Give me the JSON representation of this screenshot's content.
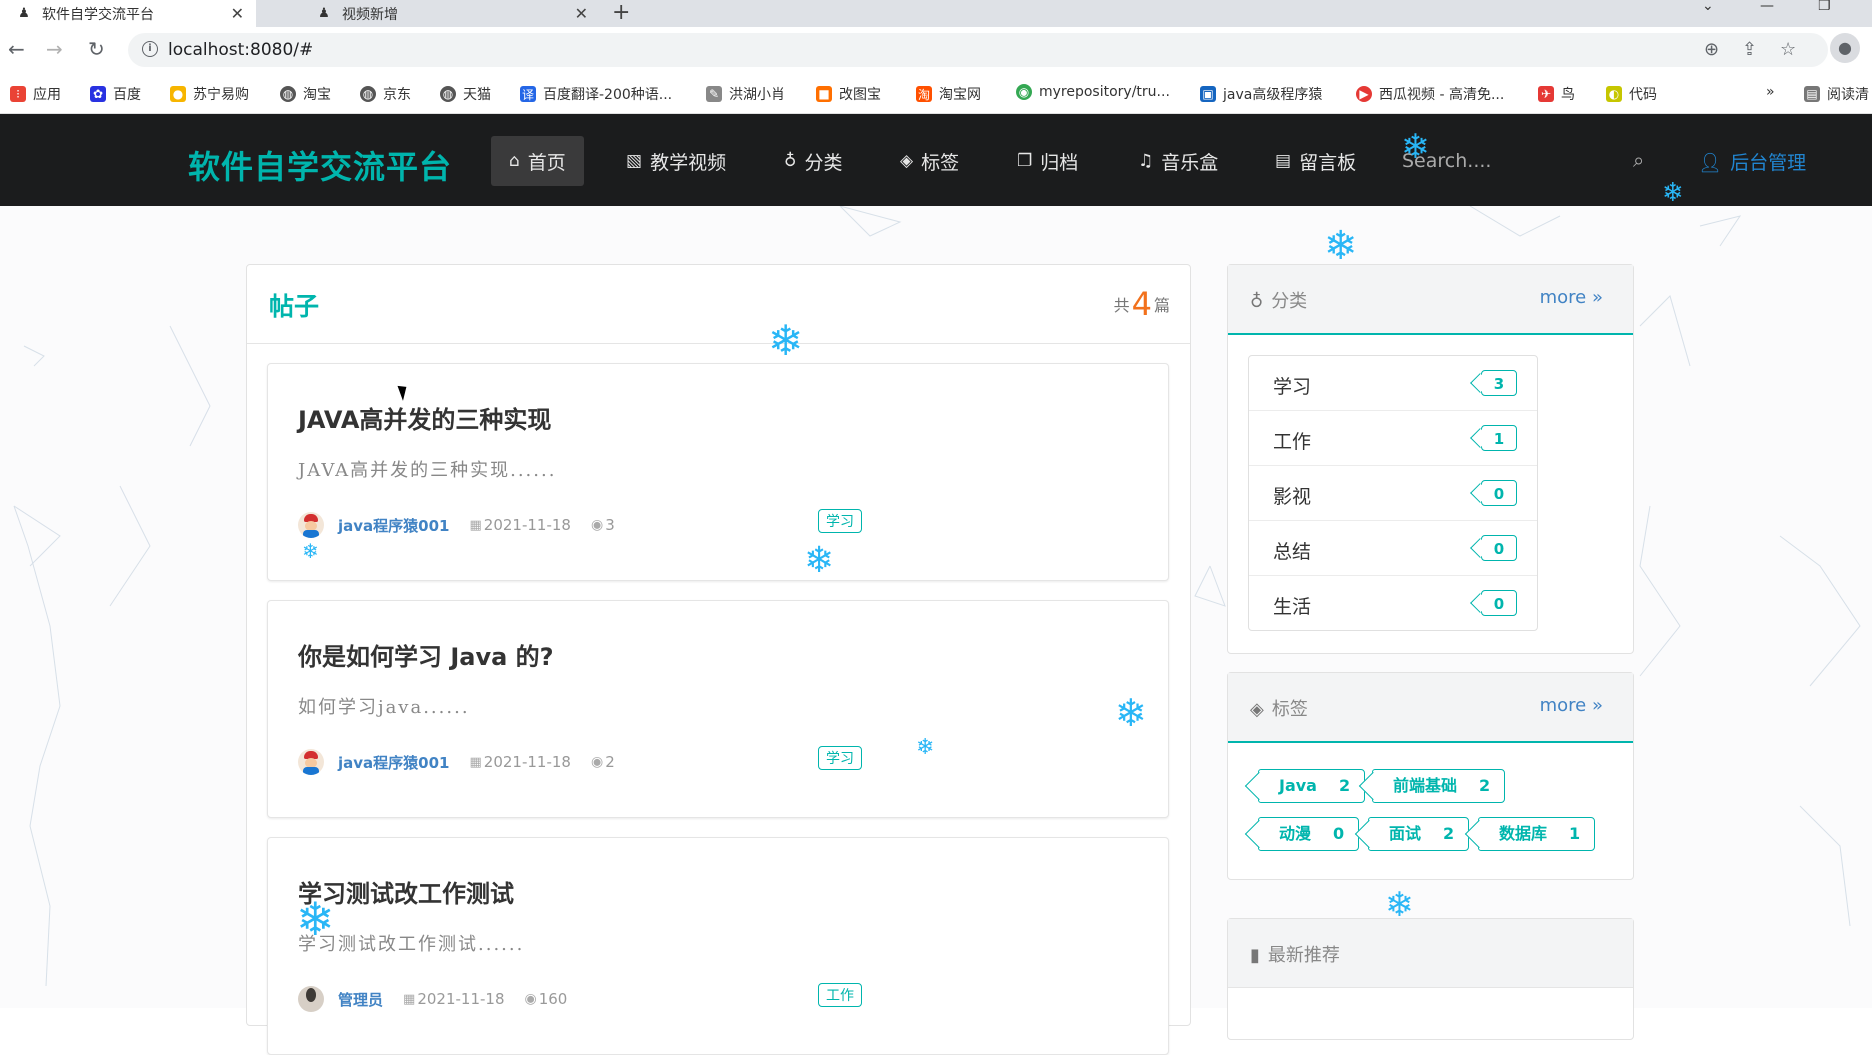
{
  "browser": {
    "tabs": [
      {
        "title": "软件自学交流平台",
        "active": true
      },
      {
        "title": "视频新增",
        "active": false
      }
    ],
    "url": "localhost:8080/#",
    "bookmarks": [
      {
        "label": "应用",
        "color": "#4285f4"
      },
      {
        "label": "百度",
        "color": "#2932e1"
      },
      {
        "label": "苏宁易购",
        "color": "#f7b500"
      },
      {
        "label": "淘宝",
        "color": "#555555"
      },
      {
        "label": "京东",
        "color": "#555555"
      },
      {
        "label": "天猫",
        "color": "#555555"
      },
      {
        "label": "百度翻译-200种语...",
        "color": "#2466e6"
      },
      {
        "label": "洪湖小肖",
        "color": "#888888"
      },
      {
        "label": "改图宝",
        "color": "#ff6f00"
      },
      {
        "label": "淘宝网",
        "color": "#ff5000"
      },
      {
        "label": "myrepository/tru...",
        "color": "#34a853"
      },
      {
        "label": "java高级程序猿",
        "color": "#1565c0"
      },
      {
        "label": "西瓜视频 - 高清免...",
        "color": "#e53935"
      },
      {
        "label": "鸟",
        "color": "#e53935"
      },
      {
        "label": "代码",
        "color": "#c6c600"
      }
    ],
    "overflow": "»",
    "reading_list": "阅读清"
  },
  "site": {
    "brand": "软件自学交流平台",
    "menu": [
      {
        "label": "首页",
        "icon": "home-icon",
        "glyph": "⌂"
      },
      {
        "label": "教学视频",
        "icon": "image-icon",
        "glyph": "▧"
      },
      {
        "label": "分类",
        "icon": "lightbulb-icon",
        "glyph": "♁"
      },
      {
        "label": "标签",
        "icon": "tags-icon",
        "glyph": "◈"
      },
      {
        "label": "归档",
        "icon": "copy-icon",
        "glyph": "❐"
      },
      {
        "label": "音乐盒",
        "icon": "music-icon",
        "glyph": "♫"
      },
      {
        "label": "留言板",
        "icon": "book-icon",
        "glyph": "▤"
      }
    ],
    "search_placeholder": "Search....",
    "admin": "后台管理"
  },
  "posts": {
    "title": "帖子",
    "count_prefix": "共",
    "count": "4",
    "count_suffix": "篇",
    "items": [
      {
        "title": "JAVA高并发的三种实现",
        "excerpt": "JAVA高并发的三种实现......",
        "author": "java程序猿001",
        "date": "2021-11-18",
        "views": "3",
        "tag": "学习"
      },
      {
        "title": "你是如何学习 Java 的?",
        "excerpt": "如何学习java......",
        "author": "java程序猿001",
        "date": "2021-11-18",
        "views": "2",
        "tag": "学习"
      },
      {
        "title": "学习测试改工作测试",
        "excerpt": "学习测试改工作测试......",
        "author": "管理员",
        "date": "2021-11-18",
        "views": "160",
        "tag": "工作"
      }
    ]
  },
  "sidebar": {
    "categories": {
      "title": "分类",
      "more": "more",
      "items": [
        {
          "name": "学习",
          "count": "3"
        },
        {
          "name": "工作",
          "count": "1"
        },
        {
          "name": "影视",
          "count": "0"
        },
        {
          "name": "总结",
          "count": "0"
        },
        {
          "name": "生活",
          "count": "0"
        }
      ]
    },
    "tags": {
      "title": "标签",
      "more": "more",
      "items": [
        {
          "name": "Java",
          "count": "2"
        },
        {
          "name": "前端基础",
          "count": "2"
        },
        {
          "name": "动漫",
          "count": "0"
        },
        {
          "name": "面试",
          "count": "2"
        },
        {
          "name": "数据库",
          "count": "1"
        }
      ]
    },
    "recommend": {
      "title": "最新推荐"
    }
  },
  "colors": {
    "accent": "#00b5ad",
    "link": "#4183c4",
    "count": "#f2711c",
    "navbar": "#1b1c1d"
  }
}
